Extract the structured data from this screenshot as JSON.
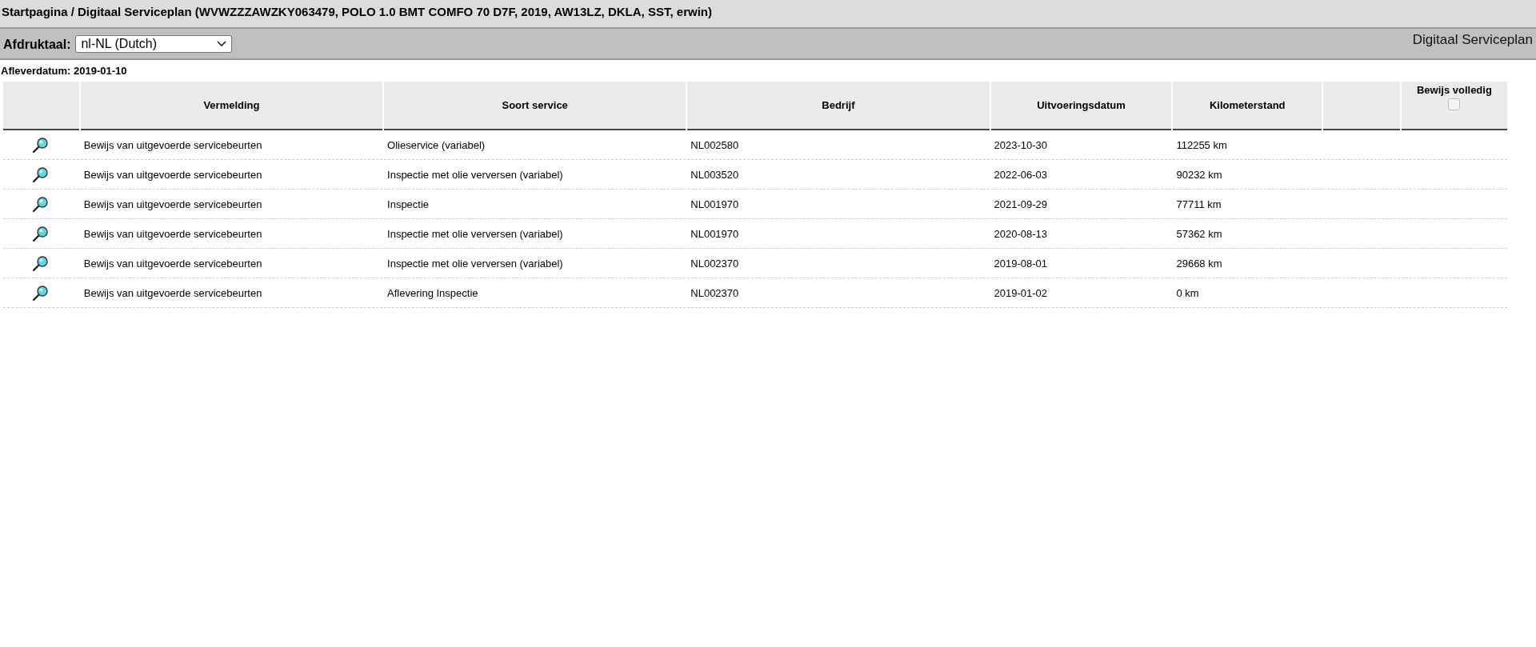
{
  "breadcrumb": "Startpagina / Digitaal Serviceplan (WVWZZZAWZKY063479, POLO 1.0 BMT COMFO 70 D7F, 2019, AW13LZ, DKLA, SST, erwin)",
  "toolbar": {
    "language_label": "Afdruktaal:",
    "language_value": "nl-NL (Dutch)",
    "title": "Digitaal Serviceplan"
  },
  "delivery_date": "Afleverdatum: 2019-01-10",
  "table": {
    "columns": [
      "",
      "Vermelding",
      "Soort service",
      "Bedrijf",
      "Uitvoeringsdatum",
      "Kilometerstand",
      "",
      "Bewijs volledig"
    ],
    "proof_complete_checkbox": {
      "checked": false
    },
    "rows": [
      {
        "entry": "Bewijs van uitgevoerde servicebeurten",
        "service": "Olieservice (variabel)",
        "company": "NL002580",
        "date": "2023-10-30",
        "mileage": "112255 km"
      },
      {
        "entry": "Bewijs van uitgevoerde servicebeurten",
        "service": "Inspectie met olie verversen (variabel)",
        "company": "NL003520",
        "date": "2022-06-03",
        "mileage": "90232 km"
      },
      {
        "entry": "Bewijs van uitgevoerde servicebeurten",
        "service": "Inspectie",
        "company": "NL001970",
        "date": "2021-09-29",
        "mileage": "77711 km"
      },
      {
        "entry": "Bewijs van uitgevoerde servicebeurten",
        "service": "Inspectie met olie verversen (variabel)",
        "company": "NL001970",
        "date": "2020-08-13",
        "mileage": "57362 km"
      },
      {
        "entry": "Bewijs van uitgevoerde servicebeurten",
        "service": "Inspectie met olie verversen (variabel)",
        "company": "NL002370",
        "date": "2019-08-01",
        "mileage": "29668 km"
      },
      {
        "entry": "Bewijs van uitgevoerde servicebeurten",
        "service": "Aflevering Inspectie",
        "company": "NL002370",
        "date": "2019-01-02",
        "mileage": "0 km"
      }
    ]
  }
}
